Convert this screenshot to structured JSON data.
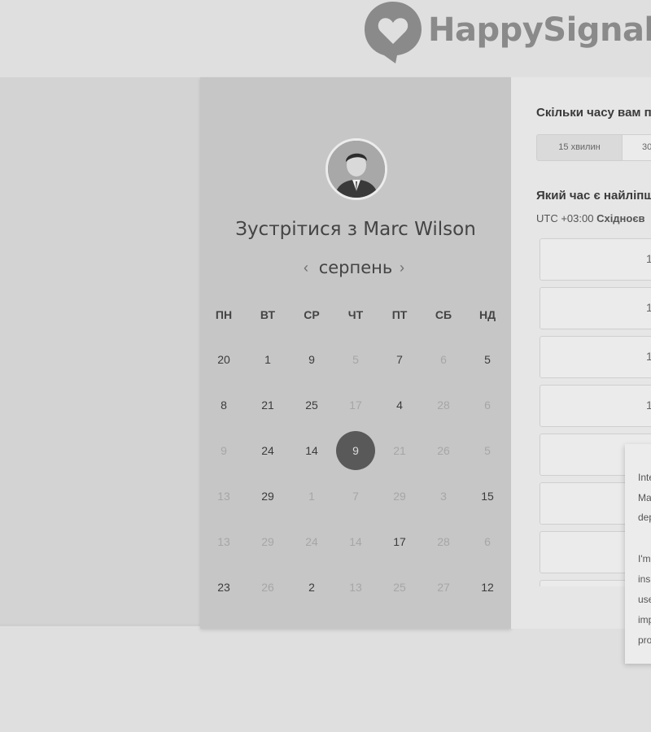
{
  "header": {
    "logo_text": "HappySignals"
  },
  "calendar": {
    "title_prefix": "Зустрітися з",
    "host_name": "Marc Wilson",
    "month": "серпень",
    "prev_icon": "‹",
    "next_icon": "›",
    "weekdays": [
      "ПН",
      "ВТ",
      "СР",
      "ЧТ",
      "ПТ",
      "СБ",
      "НД"
    ],
    "weeks": [
      [
        {
          "d": "20",
          "m": false
        },
        {
          "d": "1",
          "m": false
        },
        {
          "d": "9",
          "m": false
        },
        {
          "d": "5",
          "m": true
        },
        {
          "d": "7",
          "m": false
        },
        {
          "d": "6",
          "m": true
        },
        {
          "d": "5",
          "m": false
        }
      ],
      [
        {
          "d": "8",
          "m": false
        },
        {
          "d": "21",
          "m": false
        },
        {
          "d": "25",
          "m": false
        },
        {
          "d": "17",
          "m": true
        },
        {
          "d": "4",
          "m": false
        },
        {
          "d": "28",
          "m": true
        },
        {
          "d": "6",
          "m": true
        }
      ],
      [
        {
          "d": "9",
          "m": true
        },
        {
          "d": "24",
          "m": false
        },
        {
          "d": "14",
          "m": false
        },
        {
          "d": "9",
          "m": false,
          "s": true
        },
        {
          "d": "21",
          "m": true
        },
        {
          "d": "26",
          "m": true
        },
        {
          "d": "5",
          "m": true
        }
      ],
      [
        {
          "d": "13",
          "m": true
        },
        {
          "d": "29",
          "m": false
        },
        {
          "d": "1",
          "m": true
        },
        {
          "d": "7",
          "m": true
        },
        {
          "d": "29",
          "m": true
        },
        {
          "d": "3",
          "m": true
        },
        {
          "d": "15",
          "m": false
        }
      ],
      [
        {
          "d": "13",
          "m": true
        },
        {
          "d": "29",
          "m": true
        },
        {
          "d": "24",
          "m": true
        },
        {
          "d": "14",
          "m": true
        },
        {
          "d": "17",
          "m": false
        },
        {
          "d": "28",
          "m": true
        },
        {
          "d": "6",
          "m": true
        }
      ],
      [
        {
          "d": "23",
          "m": false
        },
        {
          "d": "26",
          "m": true
        },
        {
          "d": "2",
          "m": false
        },
        {
          "d": "13",
          "m": true
        },
        {
          "d": "25",
          "m": true
        },
        {
          "d": "27",
          "m": true
        },
        {
          "d": "12",
          "m": false
        }
      ]
    ]
  },
  "scheduler": {
    "duration_question": "Скільки часу вам п",
    "durations": [
      {
        "label": "15 хвилин",
        "active": true
      },
      {
        "label": "30",
        "active": false
      }
    ],
    "time_question": "Який час є найліпш",
    "timezone_prefix": "UTC +03:00",
    "timezone_name": "Східноєв",
    "slots": [
      "1",
      "1",
      "1",
      "1",
      "",
      "",
      "",
      ""
    ]
  },
  "popup": {
    "lines": [
      "Inte",
      "Ma",
      "dep",
      "",
      "I'm",
      "ins",
      "use",
      "imp",
      "pro"
    ]
  },
  "colors": {
    "background": "#dfdfdf",
    "calendar_bg": "#c6c6c6",
    "selected_day": "#595959",
    "logo": "#8a8a8a"
  }
}
